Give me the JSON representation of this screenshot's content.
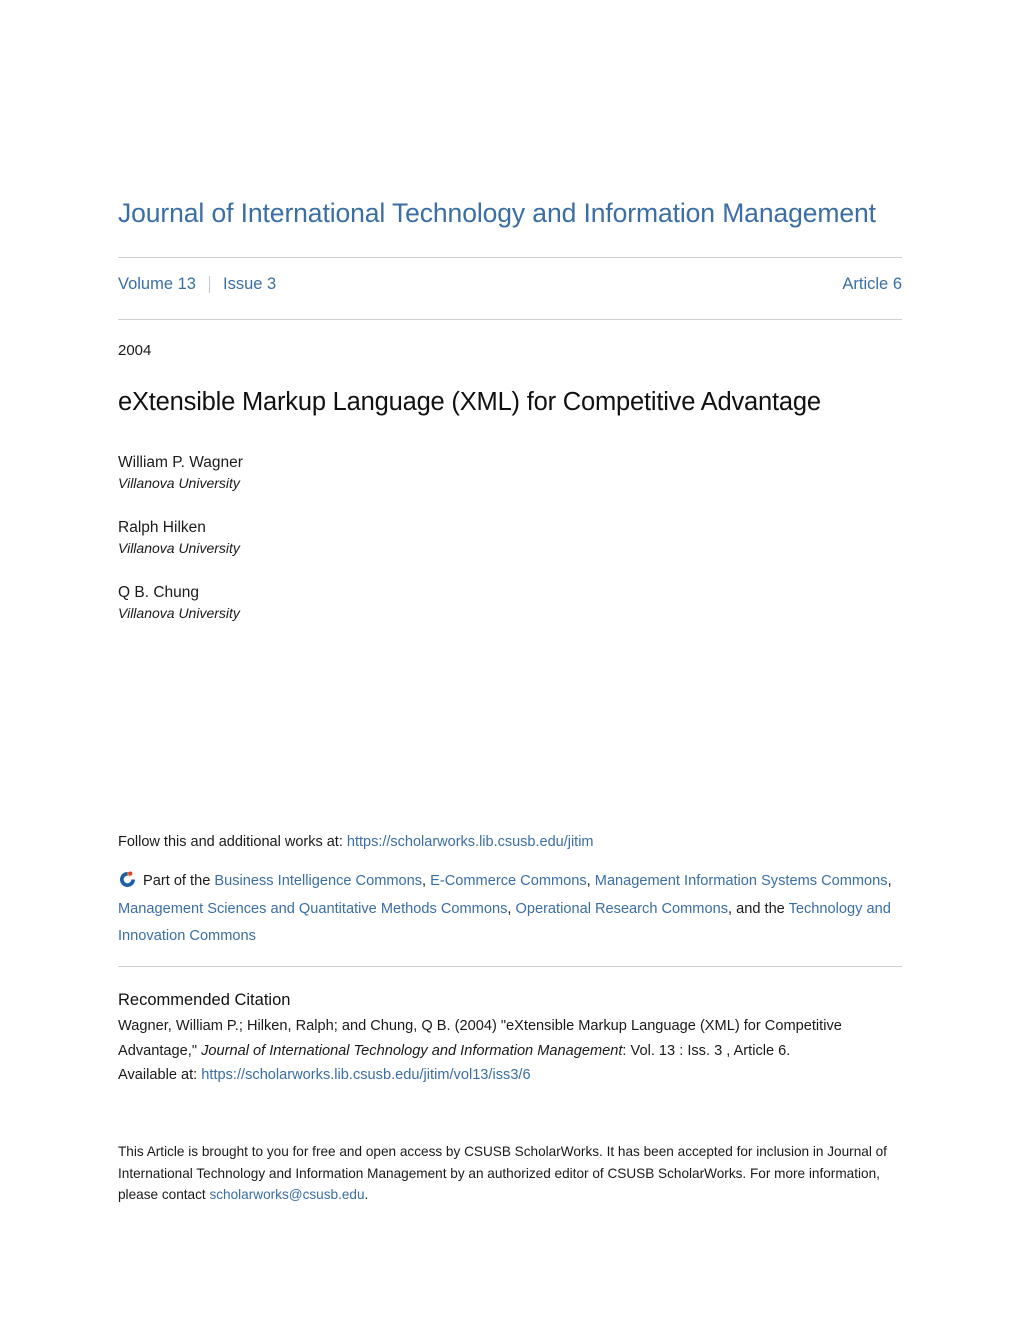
{
  "header": {
    "journal_title": "Journal of International Technology and Information Management",
    "volume_label": "Volume 13",
    "issue_label": "Issue 3",
    "article_label": "Article 6"
  },
  "article": {
    "year": "2004",
    "title": "eXtensible Markup Language (XML) for Competitive Advantage",
    "authors": [
      {
        "name": "William P. Wagner",
        "affiliation": "Villanova University"
      },
      {
        "name": "Ralph Hilken",
        "affiliation": "Villanova University"
      },
      {
        "name": "Q B. Chung",
        "affiliation": "Villanova University"
      }
    ]
  },
  "follow": {
    "prefix": "Follow this and additional works at: ",
    "url": "https://scholarworks.lib.csusb.edu/jitim"
  },
  "commons": {
    "icon_name": "digital-commons-icon",
    "prefix": "Part of the ",
    "links": [
      "Business Intelligence Commons",
      "E-Commerce Commons",
      "Management Information Systems Commons",
      "Management Sciences and Quantitative Methods Commons",
      "Operational Research Commons",
      "Technology and Innovation Commons"
    ],
    "sep": ", ",
    "last_sep": ", and the "
  },
  "citation": {
    "heading": "Recommended Citation",
    "authors_part": "Wagner, William P.; Hilken, Ralph; and Chung, Q B. (2004) \"eXtensible Markup Language (XML) for Competitive Advantage,\" ",
    "journal_italic": "Journal of International Technology and Information Management",
    "locator": ": Vol. 13 : Iss. 3 , Article 6.",
    "available_prefix": "Available at: ",
    "available_url": "https://scholarworks.lib.csusb.edu/jitim/vol13/iss3/6"
  },
  "footer": {
    "text_before_email": "This Article is brought to you for free and open access by CSUSB ScholarWorks. It has been accepted for inclusion in Journal of International Technology and Information Management by an authorized editor of CSUSB ScholarWorks. For more information, please contact ",
    "email": "scholarworks@csusb.edu",
    "text_after_email": "."
  },
  "colors": {
    "accent_blue": "#3a6ea5",
    "rule_gray": "#cfcfcf",
    "text_black": "#1a1a1a"
  }
}
